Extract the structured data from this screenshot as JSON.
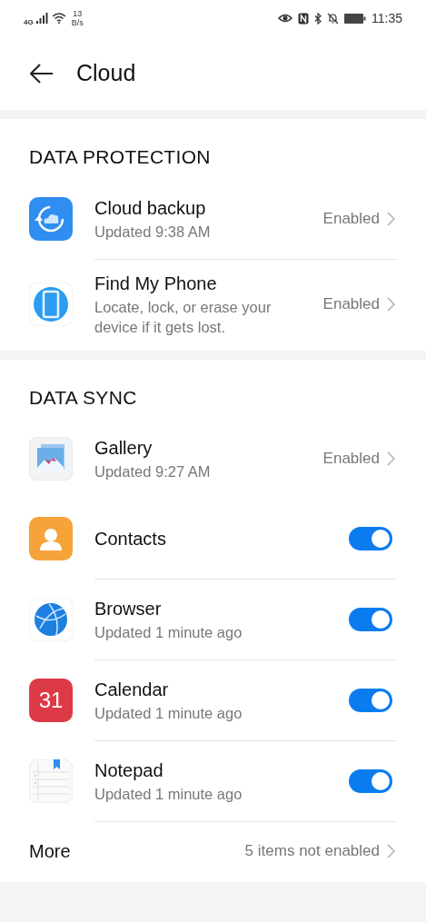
{
  "status_bar": {
    "network": "4G",
    "speed_value": "13",
    "speed_unit": "B/s",
    "time": "11:35"
  },
  "header": {
    "title": "Cloud"
  },
  "sections": [
    {
      "title": "DATA PROTECTION",
      "items": [
        {
          "kind": "link",
          "title": "Cloud backup",
          "subtitle": "Updated 9:38 AM",
          "status": "Enabled",
          "divider_below": true
        },
        {
          "kind": "link",
          "title": "Find My Phone",
          "subtitle": "Locate, lock, or erase your device if it gets lost.",
          "status": "Enabled",
          "divider_below": false
        }
      ]
    },
    {
      "title": "DATA SYNC",
      "items": [
        {
          "kind": "link",
          "title": "Gallery",
          "subtitle": "Updated 9:27 AM",
          "status": "Enabled",
          "divider_below": false
        },
        {
          "kind": "toggle",
          "title": "Contacts",
          "on": true,
          "divider_below": true
        },
        {
          "kind": "toggle",
          "title": "Browser",
          "subtitle": "Updated 1 minute ago",
          "on": true,
          "divider_below": true
        },
        {
          "kind": "toggle",
          "title": "Calendar",
          "subtitle": "Updated 1 minute ago",
          "icon_text": "31",
          "on": true,
          "divider_below": true
        },
        {
          "kind": "toggle",
          "title": "Notepad",
          "subtitle": "Updated 1 minute ago",
          "on": true,
          "divider_below": true
        },
        {
          "kind": "more",
          "title": "More",
          "status": "5 items not enabled",
          "divider_below": false
        }
      ]
    }
  ]
}
